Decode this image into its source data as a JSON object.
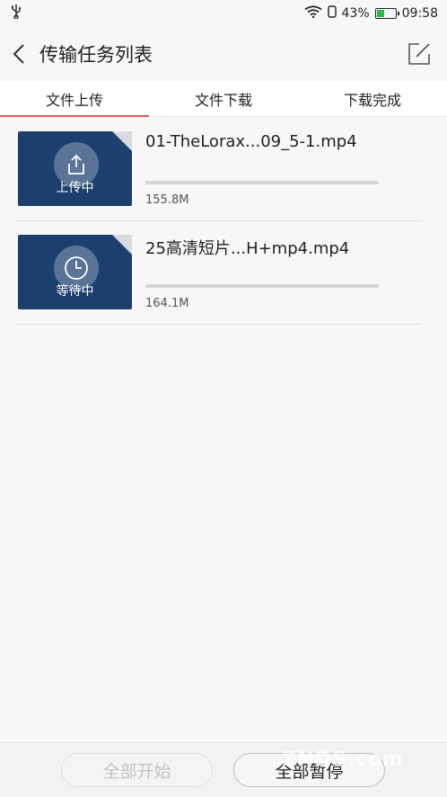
{
  "status_bar": {
    "battery_percent": "43%",
    "battery_level": 0.43,
    "time": "09:58",
    "battery_color": "#2db84c"
  },
  "header": {
    "title": "传输任务列表"
  },
  "tabs": [
    {
      "label": "文件上传",
      "active": true
    },
    {
      "label": "文件下载",
      "active": false
    },
    {
      "label": "下载完成",
      "active": false
    }
  ],
  "accent_color": "#e85a4f",
  "tasks": [
    {
      "name": "01-TheLorax...09_5-1.mp4",
      "status": "上传中",
      "status_icon": "upload-icon",
      "size": "155.8M",
      "progress": 0
    },
    {
      "name": "25高清短片...H+mp4.mp4",
      "status": "等待中",
      "status_icon": "clock-icon",
      "size": "164.1M",
      "progress": 0
    }
  ],
  "bottom": {
    "start_all": "全部开始",
    "pause_all": "全部暂停",
    "watermark": "ZNDS.com"
  }
}
